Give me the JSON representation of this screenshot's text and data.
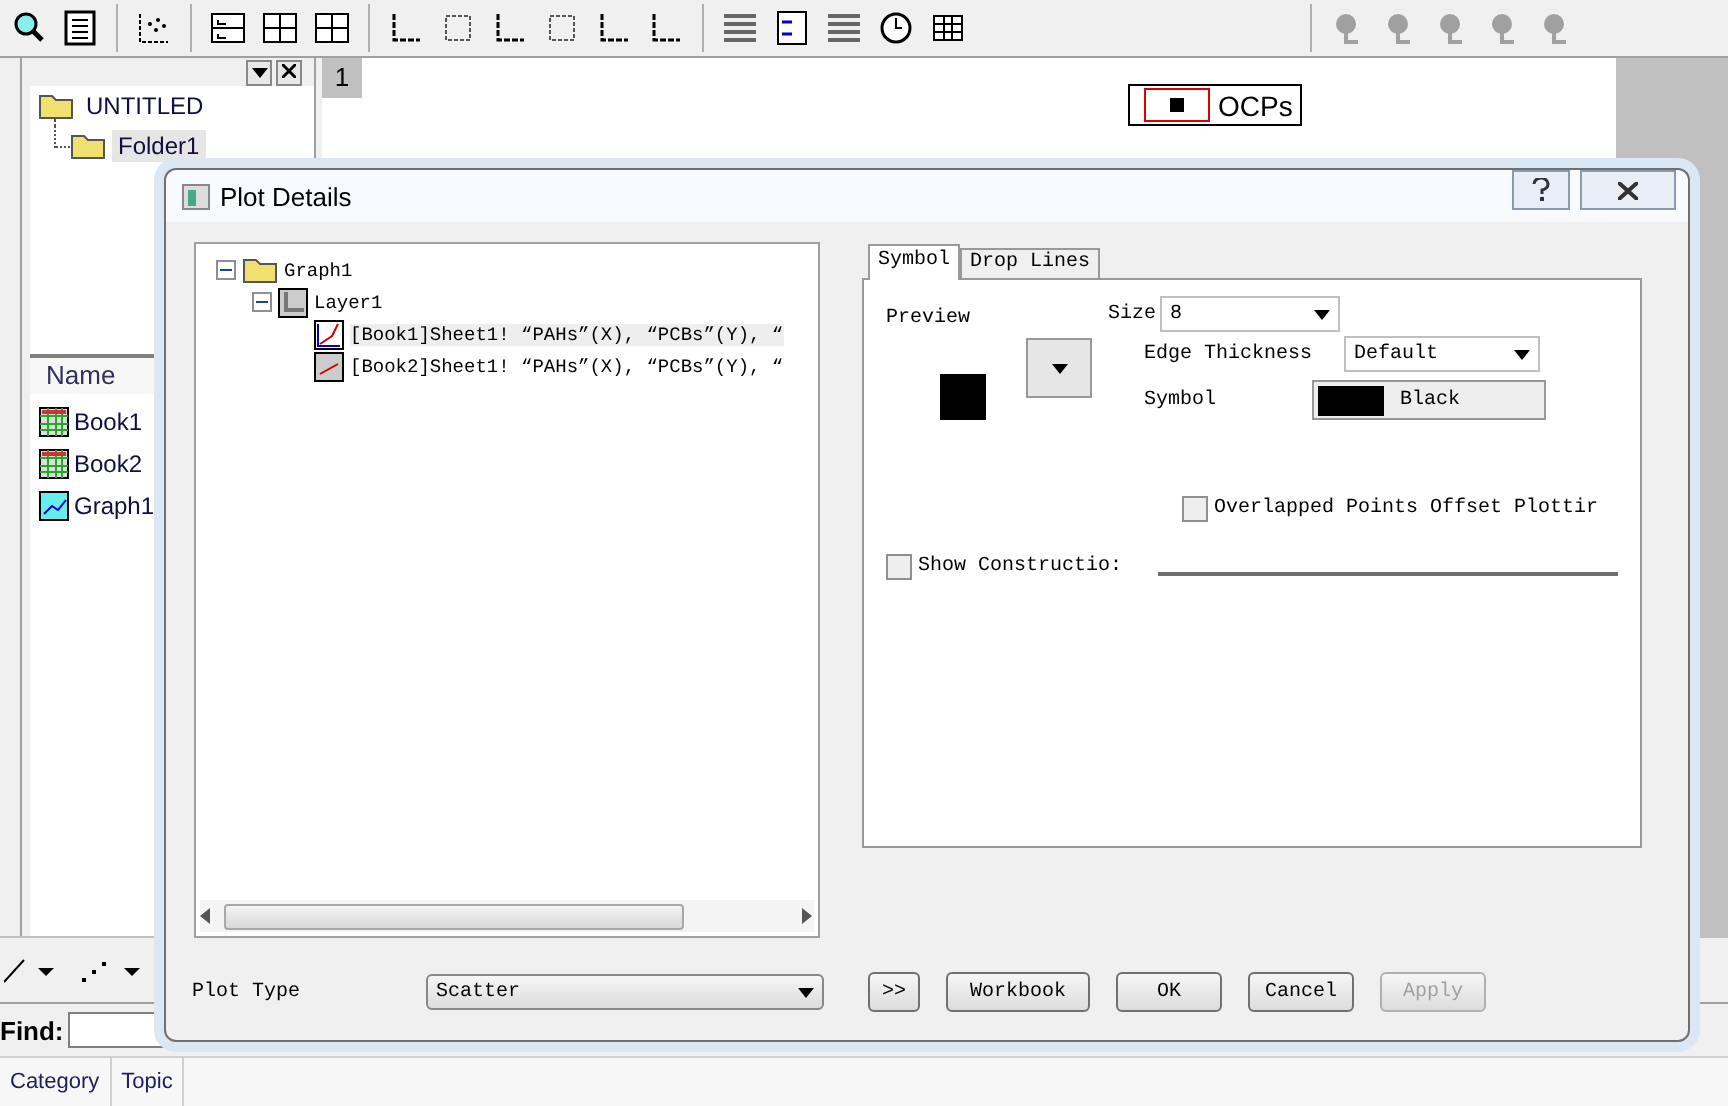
{
  "project_explorer": {
    "tree": [
      {
        "label": "UNTITLED",
        "kind": "root",
        "expanded": true,
        "selected": false,
        "children": [
          {
            "label": "Folder1",
            "kind": "folder",
            "selected": true
          }
        ]
      }
    ],
    "list_header": "Name",
    "items": [
      {
        "label": "Book1",
        "kind": "workbook"
      },
      {
        "label": "Book2",
        "kind": "workbook"
      },
      {
        "label": "Graph1",
        "kind": "graph"
      }
    ]
  },
  "graph": {
    "page": "1",
    "legend": "OCPs"
  },
  "find": {
    "label": "Find:"
  },
  "bottom_tabs": [
    {
      "label": "Category"
    },
    {
      "label": "Topic"
    }
  ],
  "dialog": {
    "title": "Plot Details",
    "tree": [
      {
        "label": "Graph1",
        "kind": "graph",
        "expanded": true,
        "selected": false,
        "children": [
          {
            "label": "Layer1",
            "kind": "layer",
            "expanded": true,
            "selected": false,
            "children": [
              {
                "label": "[Book1]Sheet1! “PAHs”(X), “PCBs”(Y), “",
                "kind": "plot-active",
                "selected": true
              },
              {
                "label": "[Book2]Sheet1! “PAHs”(X), “PCBs”(Y), “",
                "kind": "plot",
                "selected": false
              }
            ]
          }
        ]
      }
    ],
    "tabs": [
      {
        "label": "Symbol",
        "selected": true
      },
      {
        "label": "Drop Lines",
        "selected": false
      }
    ],
    "preview_label": "Preview",
    "size": {
      "label": "Size",
      "value": "8"
    },
    "edge_thickness": {
      "label": "Edge Thickness",
      "value": "Default"
    },
    "symbol_color": {
      "label": "Symbol",
      "value": "Black",
      "color": "#000000"
    },
    "checkboxes": [
      {
        "label": "Overlapped Points Offset Plottir",
        "checked": false
      },
      {
        "label": "Show Constructio:",
        "checked": false
      }
    ],
    "plot_type": {
      "label": "Plot Type",
      "value": "Scatter"
    },
    "buttons": [
      {
        "label": ">>",
        "disabled": false
      },
      {
        "label": "Workbook",
        "disabled": false
      },
      {
        "label": "OK",
        "disabled": false
      },
      {
        "label": "Cancel",
        "disabled": false
      },
      {
        "label": "Apply",
        "disabled": true
      }
    ]
  }
}
